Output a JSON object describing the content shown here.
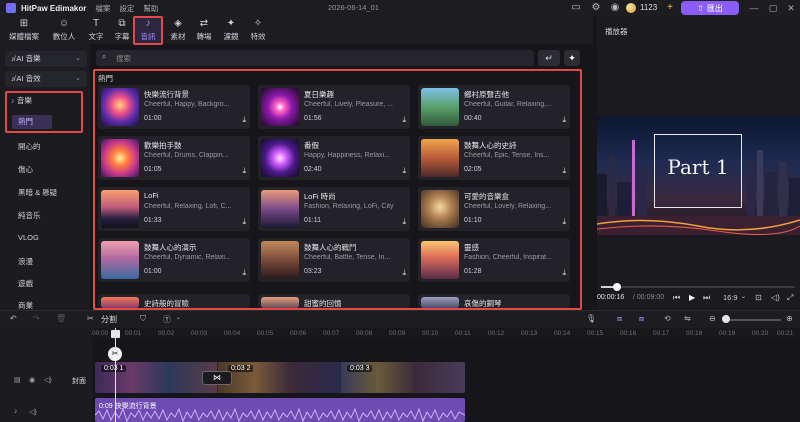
{
  "app": {
    "title": "HitPaw Edimakor",
    "menus": [
      "檔案",
      "設定",
      "幫助"
    ],
    "doc_title": "2026-06-14_01",
    "credits": "1123",
    "export_label": "匯出"
  },
  "toolbar": {
    "tools": [
      {
        "label": "媒體檔案",
        "icon": "media-icon"
      },
      {
        "label": "數位人",
        "icon": "avatar-icon"
      },
      {
        "label": "文字",
        "icon": "text-icon"
      },
      {
        "label": "字幕",
        "icon": "subtitle-icon"
      },
      {
        "label": "音訊",
        "icon": "music-note-icon",
        "active": true
      },
      {
        "label": "素材",
        "icon": "sticker-icon"
      },
      {
        "label": "轉場",
        "icon": "transition-icon"
      },
      {
        "label": "濾鏡",
        "icon": "filter-icon"
      },
      {
        "label": "特效",
        "icon": "effects-icon"
      }
    ]
  },
  "sidebar": {
    "ai_music": "AI 音樂",
    "ai_sfx": "AI 音效",
    "music": "音樂",
    "hot": "熱門",
    "categories": [
      "開心的",
      "傷心",
      "黑暗 & 懸疑",
      "純音乐",
      "VLOG",
      "浪漫",
      "遊戲",
      "商業"
    ]
  },
  "search": {
    "placeholder": "搜索"
  },
  "section_title": "熱門",
  "tracks": [
    {
      "title": "快樂流行背景",
      "tags": "Cheerful, Happy, Backgro...",
      "duration": "01:00"
    },
    {
      "title": "夏日樂趣",
      "tags": "Cheerful, Lively, Pleasure, ...",
      "duration": "01:56"
    },
    {
      "title": "鄉村原聲吉他",
      "tags": "Cheerful, Guitar, Relaxing,...",
      "duration": "00:40"
    },
    {
      "title": "歡樂拍手鼓",
      "tags": "Cheerful, Drums, Clappin...",
      "duration": "01:05"
    },
    {
      "title": "番假",
      "tags": "Happy, Happiness, Relaxi...",
      "duration": "02:40"
    },
    {
      "title": "鼓舞人心的史詩",
      "tags": "Cheerful, Epic, Tense, Ins...",
      "duration": "02:05"
    },
    {
      "title": "LoFi",
      "tags": "Cheerful, Relaxing, Lofi, C...",
      "duration": "01:33"
    },
    {
      "title": "LoFi 時尚",
      "tags": "Fashion, Relaxing, LoFi, City",
      "duration": "01:11"
    },
    {
      "title": "可愛的音樂盒",
      "tags": "Cheerful, Lovely, Relaxing...",
      "duration": "01:10"
    },
    {
      "title": "鼓舞人心的演示",
      "tags": "Cheerful, Dynamic, Relaxi...",
      "duration": "01:00"
    },
    {
      "title": "鼓舞人心的戰鬥",
      "tags": "Cheerful, Battle, Tense, In...",
      "duration": "03:23"
    },
    {
      "title": "靈感",
      "tags": "Fashion, Cheerful, Inspirat...",
      "duration": "01:28"
    },
    {
      "title": "史詩般的冒險",
      "tags": "",
      "duration": ""
    },
    {
      "title": "甜蜜的回憶",
      "tags": "",
      "duration": ""
    },
    {
      "title": "哀傷的鋼琴",
      "tags": "",
      "duration": ""
    }
  ],
  "player": {
    "title": "播放器",
    "preview_text": "Part 1",
    "current_time": "00:00:16",
    "total_time": "/ 00:09:00",
    "progress": 0.03,
    "aspect": "16:9"
  },
  "timeline": {
    "split_label": "分割",
    "ruler": [
      "00:00",
      "00:01",
      "00:02",
      "00:03",
      "00:04",
      "00:05",
      "00:06",
      "00:07",
      "00:08",
      "00:09",
      "00:10",
      "00:11",
      "00:12",
      "00:13",
      "00:14",
      "00:15",
      "00:16",
      "00:17",
      "00:18",
      "00:19",
      "00:20",
      "00:21"
    ],
    "cover_label": "封面",
    "clips": [
      "0:03 1",
      "0:03 2",
      "0:03 3"
    ],
    "audio_label": "0:09 快樂流行背景"
  }
}
